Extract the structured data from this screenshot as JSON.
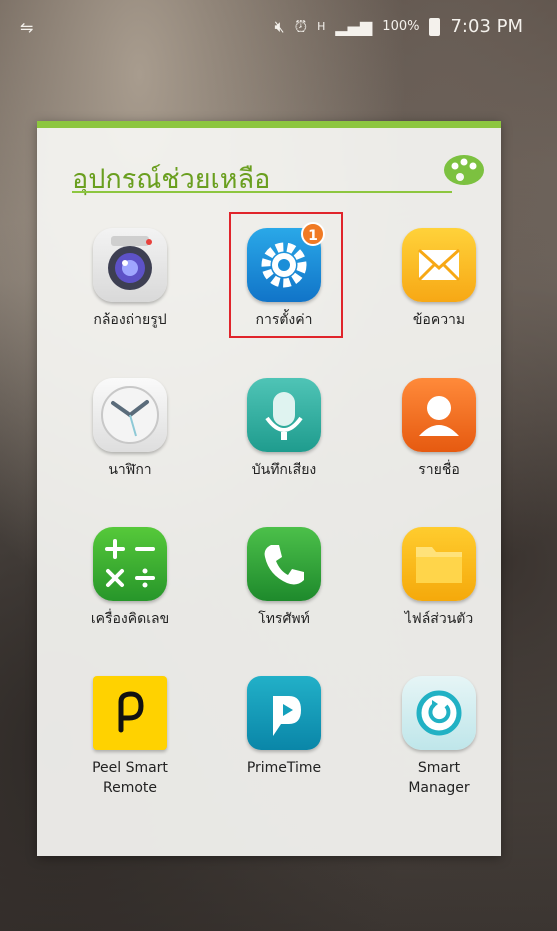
{
  "status_bar": {
    "left_icon": "usb-icon",
    "icons": [
      "mute-icon",
      "alarm-icon",
      "hplus-data-icon",
      "signal-icon"
    ],
    "battery_percent": "100%",
    "time": "7:03 PM"
  },
  "folder": {
    "title": "อุปกรณ์ช่วยเหลือ",
    "palette_icon": "palette-icon",
    "accent_color": "#8dc63f",
    "apps": [
      {
        "label": "กล้องถ่ายรูป",
        "icon": "camera-icon"
      },
      {
        "label": "การตั้งค่า",
        "icon": "settings-icon",
        "badge": "1",
        "highlighted": true
      },
      {
        "label": "ข้อความ",
        "icon": "messages-icon"
      },
      {
        "label": "นาฬิกา",
        "icon": "clock-icon"
      },
      {
        "label": "บันทึกเสียง",
        "icon": "voice-recorder-icon"
      },
      {
        "label": "รายชื่อ",
        "icon": "contacts-icon"
      },
      {
        "label": "เครื่องคิดเลข",
        "icon": "calculator-icon"
      },
      {
        "label": "โทรศัพท์",
        "icon": "phone-icon"
      },
      {
        "label": "ไฟล์ส่วนตัว",
        "icon": "my-files-icon"
      },
      {
        "label": "Peel Smart\nRemote",
        "icon": "peel-icon"
      },
      {
        "label": "PrimeTime",
        "icon": "primetime-icon"
      },
      {
        "label": "Smart\nManager",
        "icon": "smart-manager-icon"
      }
    ]
  }
}
